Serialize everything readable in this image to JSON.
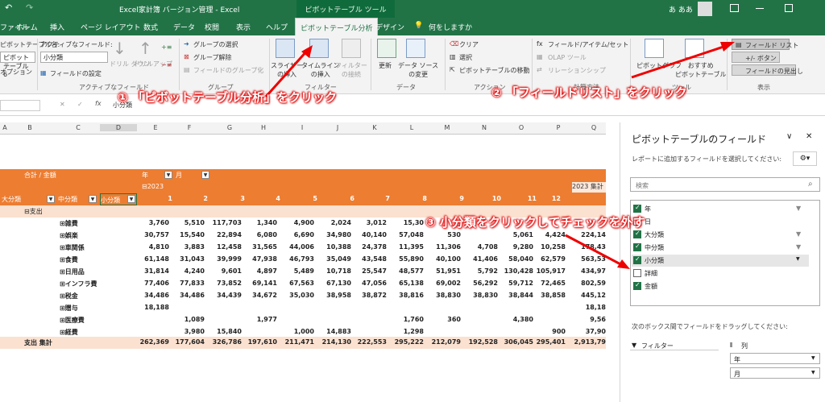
{
  "titlebar": {
    "undo": "↶",
    "redo": "↷",
    "title": "Excel家計簿 バージョン管理 - Excel",
    "pivot_tools": "ピボットテーブル ツール",
    "user": "あ ああ"
  },
  "tabs": [
    "ファイル",
    "ホーム",
    "挿入",
    "ページ レイアウト",
    "数式",
    "データ",
    "校閲",
    "表示",
    "ヘルプ",
    "ピボットテーブル分析",
    "デザイン",
    "何をしますか"
  ],
  "ribbon": {
    "pivot_name_label": "ピボットテーブル名:",
    "pivot_name_value": "ピボットテーブル6",
    "options_label": "オプション",
    "active_field_label": "アクティブなフィールド:",
    "active_field_value": "小分類",
    "field_settings": "フィールドの設定",
    "drilldown": "ドリル\nダウン",
    "drillup": "ドリルアップ",
    "group_active_field": "アクティブなフィールド",
    "group_selection": "グループの選択",
    "group_ungroup": "グループ解除",
    "group_field": "フィールドのグループ化",
    "group_group": "グループ",
    "slicer": "スライサー\nの挿入",
    "timeline": "タイムライン\nの挿入",
    "filter_conn": "フィルター\nの接続",
    "group_filter": "フィルター",
    "refresh": "更新",
    "change_source": "データ ソース\nの変更",
    "group_data": "データ",
    "clear": "クリア",
    "select": "選択",
    "move_pivot": "ピボットテーブルの移動",
    "group_action": "アクション",
    "fields_items": "フィールド/アイテム/セット",
    "olap": "OLAP ツール",
    "relationships": "リレーションシップ",
    "group_calc": "計算方法",
    "pivotchart": "ピボットグラフ",
    "recommended": "おすすめ\nピボットテーブル",
    "group_tools": "ツール",
    "field_list": "フィールド リスト",
    "plus_minus": "+/- ボタン",
    "field_headers": "フィールドの見出し",
    "group_show": "表示"
  },
  "formula": {
    "name_box": "",
    "value": "小分類"
  },
  "columns": [
    "A",
    "B",
    "C",
    "D",
    "E",
    "F",
    "G",
    "H",
    "I",
    "J",
    "K",
    "L",
    "M",
    "N",
    "O",
    "P",
    "Q"
  ],
  "pivot": {
    "sum_label": "合計 / 金額",
    "year_label": "年",
    "month_label": "月",
    "year_value": "⊟2023",
    "total_col": "2023 集計",
    "hdr_major": "大分類",
    "hdr_mid": "中分類",
    "hdr_minor": "小分類",
    "months": [
      "1",
      "2",
      "3",
      "4",
      "5",
      "6",
      "7",
      "8",
      "9",
      "10",
      "11",
      "12"
    ],
    "group": "⊟支出",
    "rows": [
      {
        "name": "⊞雑費",
        "values": [
          "3,760",
          "5,510",
          "117,703",
          "1,340",
          "4,900",
          "2,024",
          "3,012",
          "15,30",
          "",
          "",
          "",
          ""
        ],
        "total": ""
      },
      {
        "name": "⊞娯楽",
        "values": [
          "30,757",
          "15,540",
          "22,894",
          "6,080",
          "6,690",
          "34,980",
          "40,140",
          "57,048",
          "530",
          "",
          "5,061",
          "4,424"
        ],
        "total": "224,14"
      },
      {
        "name": "⊞車関係",
        "values": [
          "4,810",
          "3,883",
          "12,458",
          "31,565",
          "44,006",
          "10,388",
          "24,378",
          "11,395",
          "11,306",
          "4,708",
          "9,280",
          "10,258"
        ],
        "total": "178,43"
      },
      {
        "name": "⊞食費",
        "values": [
          "61,148",
          "31,043",
          "39,999",
          "47,938",
          "46,793",
          "35,049",
          "43,548",
          "55,890",
          "40,100",
          "41,406",
          "58,040",
          "62,579"
        ],
        "total": "563,53"
      },
      {
        "name": "⊞日用品",
        "values": [
          "31,814",
          "4,240",
          "9,601",
          "4,897",
          "5,489",
          "10,718",
          "25,547",
          "48,577",
          "51,951",
          "5,792",
          "130,428",
          "105,917"
        ],
        "total": "434,97"
      },
      {
        "name": "⊞インフラ費",
        "values": [
          "77,406",
          "77,833",
          "73,852",
          "69,141",
          "67,563",
          "67,130",
          "47,056",
          "65,138",
          "69,002",
          "56,292",
          "59,712",
          "72,465"
        ],
        "total": "802,59"
      },
      {
        "name": "⊞税金",
        "values": [
          "34,486",
          "34,486",
          "34,439",
          "34,672",
          "35,030",
          "38,958",
          "38,872",
          "38,816",
          "38,830",
          "38,830",
          "38,844",
          "38,858"
        ],
        "total": "445,12"
      },
      {
        "name": "⊞贈与",
        "values": [
          "18,188",
          "",
          "",
          "",
          "",
          "",
          "",
          "",
          "",
          "",
          "",
          ""
        ],
        "total": "18,18"
      },
      {
        "name": "⊞医療費",
        "values": [
          "",
          "1,089",
          "",
          "1,977",
          "",
          "",
          "",
          "1,760",
          "360",
          "",
          "4,380",
          ""
        ],
        "total": "9,56"
      },
      {
        "name": "⊞経費",
        "values": [
          "",
          "3,980",
          "15,840",
          "",
          "1,000",
          "14,883",
          "",
          "1,298",
          "",
          "",
          "",
          "900"
        ],
        "total": "37,90"
      }
    ],
    "grand_label": "支出 集計",
    "grand_values": [
      "262,369",
      "177,604",
      "326,786",
      "197,610",
      "211,471",
      "214,130",
      "222,553",
      "295,222",
      "212,079",
      "192,528",
      "306,045",
      "295,401"
    ],
    "grand_total": "2,913,79"
  },
  "field_pane": {
    "title": "ピボットテーブルのフィールド",
    "subtitle": "レポートに追加するフィールドを選択してください:",
    "search_placeholder": "検索",
    "fields": [
      {
        "label": "年",
        "checked": true,
        "filter": true
      },
      {
        "label": "日",
        "checked": false,
        "filter": false
      },
      {
        "label": "大分類",
        "checked": true,
        "filter": true
      },
      {
        "label": "中分類",
        "checked": true,
        "filter": true
      },
      {
        "label": "小分類",
        "checked": true,
        "filter": false
      },
      {
        "label": "詳細",
        "checked": false,
        "filter": false
      },
      {
        "label": "金額",
        "checked": true,
        "filter": false
      }
    ],
    "drag_hint": "次のボックス間でフィールドをドラッグしてください:",
    "filter_area": "フィルター",
    "columns_area": "列",
    "col_items": [
      "年",
      "月"
    ]
  },
  "callouts": {
    "step1": "① 「ピボットテーブル分析」をクリック",
    "step2": "② 「フィールドリスト」をクリック",
    "step3": "③ 小分類をクリックしてチェックを外す"
  },
  "colors": {
    "excel_green": "#217346",
    "pivot_orange": "#ed7d31",
    "callout_red": "#e00000"
  }
}
